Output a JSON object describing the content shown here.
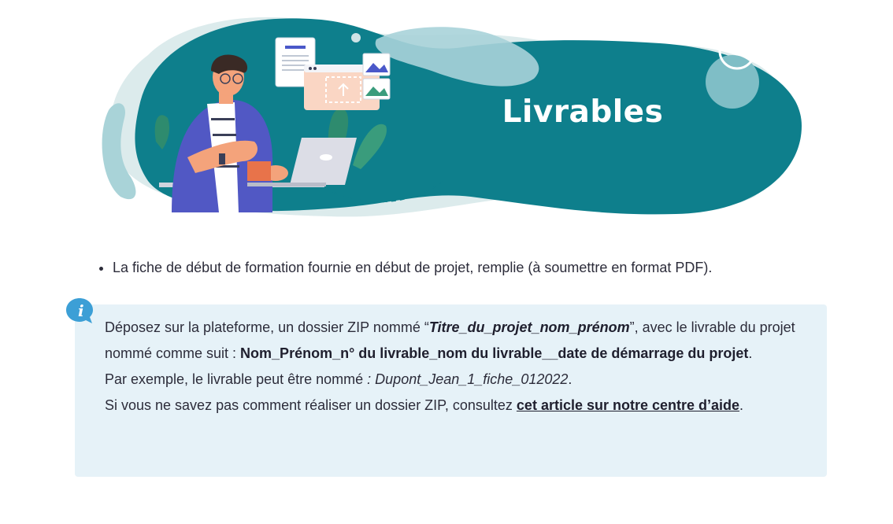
{
  "banner": {
    "title": "Livrables"
  },
  "deliverables": {
    "items": [
      "La fiche de début de formation fournie en début de projet, remplie (à soumettre en format PDF)."
    ]
  },
  "info": {
    "icon": "info-icon",
    "line1_prefix": "Déposez sur la plateforme, un dossier ZIP nommé “",
    "folder_name": "Titre_du_projet_nom_prénom",
    "line1_suffix": "”, avec le livrable du projet nommé comme suit : ",
    "naming_pattern": "Nom_Prénom_n° du livrable_nom du livrable__date de démarrage du projet",
    "line1_end": ".",
    "example_prefix": "Par exemple, le livrable peut être nommé ",
    "example_value": ": Dupont_Jean_1_fiche_012022",
    "example_end": ".",
    "help_prefix": "Si vous ne savez pas comment réaliser un dossier ZIP, consultez ",
    "help_link": "cet article sur notre centre d’aide",
    "help_end": "."
  },
  "colors": {
    "teal": "#0e7f8c",
    "light_teal": "#b3d9df",
    "info_bg": "#e6f2f8",
    "info_icon": "#3c9fd6"
  }
}
